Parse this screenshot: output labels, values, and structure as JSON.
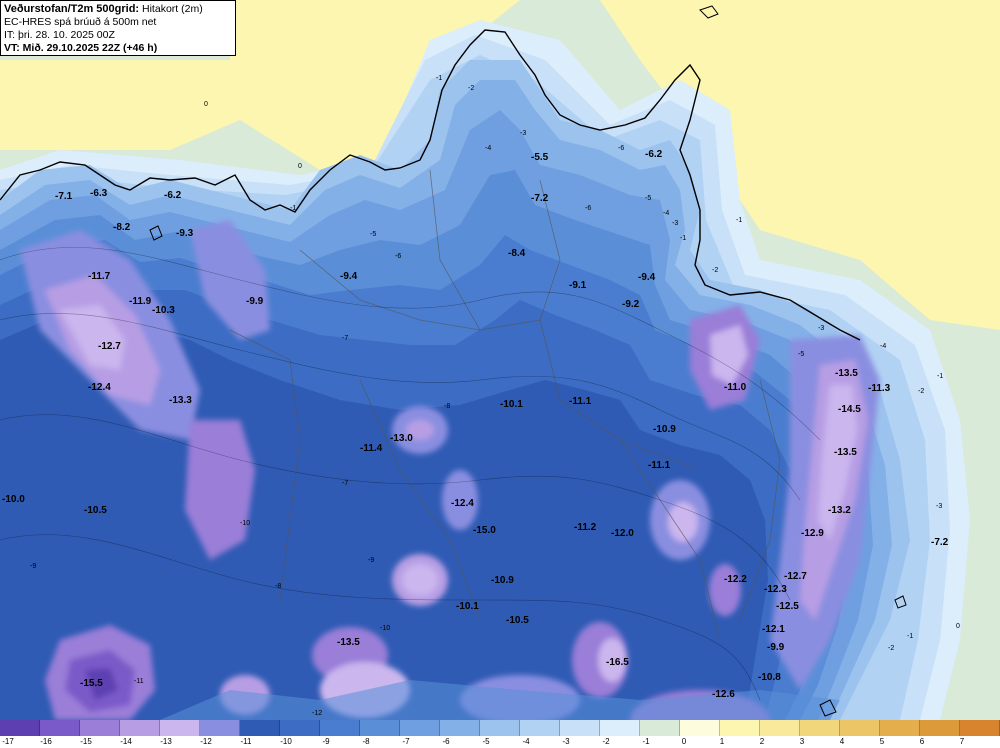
{
  "header": {
    "title": "Veðurstofan/T2m 500grid:",
    "subtitle": "Hitakort (2m)",
    "model": "EC-HRES spá brúuð á 500m net",
    "initial_time": "IT: þri. 28. 10. 2025 00Z",
    "valid_time": "VT: Mið. 29.10.2025 22Z (+46 h)"
  },
  "colors": {
    "sea": "#d9ead8",
    "land_far": "#fdf6b0",
    "coast": "#000000",
    "levels": {
      "-16": "#5d3fb2",
      "-15": "#7a5ac8",
      "-14": "#9a7ed8",
      "-13": "#b79ee4",
      "-12": "#cbb6ee",
      "-11": "#8a8ee0",
      "-10": "#2f5bb4",
      "-9": "#3c6cc4",
      "-8": "#4a7dcf",
      "-7": "#5a8fd8",
      "-6": "#6f9fe0",
      "-5": "#84b0e8",
      "-4": "#9cc2ee",
      "-3": "#b2d2f4",
      "-2": "#c8e0f8",
      "-1": "#dcedfb",
      "0": "#fdfcdc",
      "1": "#fdf6b0",
      "2": "#f8ea9a",
      "3": "#f1d67c",
      "4": "#ebc566",
      "5": "#e4ae4c",
      "6": "#dd9a3a",
      "7": "#d8842e"
    }
  },
  "map": {
    "contour_labels": [
      "0",
      "0",
      "-1",
      "-1",
      "-1",
      "-1",
      "-2",
      "-2",
      "-3",
      "-3",
      "-4",
      "-4",
      "-5",
      "-5",
      "-6",
      "-6",
      "-7",
      "-7",
      "-8",
      "-8",
      "-9",
      "-9",
      "-10",
      "-10",
      "-11",
      "-12",
      "-6",
      "-5",
      "-4",
      "-3",
      "-2",
      "-1",
      "0",
      "-1",
      "-2",
      "-3"
    ],
    "value_labels": [
      "-7.1",
      "-6.3",
      "-8.2",
      "-6.2",
      "-9.3",
      "-11.7",
      "-11.9",
      "-10.3",
      "-12.7",
      "-12.4",
      "-13.3",
      "-9.9",
      "-9.4",
      "-5.5",
      "-6.2",
      "-7.2",
      "-8.4",
      "-9.1",
      "-9.4",
      "-9.2",
      "-10.1",
      "-11.1",
      "-13.0",
      "-11.4",
      "-11.0",
      "-10.9",
      "-11.1",
      "-13.5",
      "-11.3",
      "-14.5",
      "-13.5",
      "-12.4",
      "-15.0",
      "-11.2",
      "-12.0",
      "-13.2",
      "-12.9",
      "-7.2",
      "-10.0",
      "-10.5",
      "-10.9",
      "-12.2",
      "-12.7",
      "-12.3",
      "-12.5",
      "-10.1",
      "-10.5",
      "-12.1",
      "-13.5",
      "-16.5",
      "-9.9",
      "-15.5",
      "-10.8",
      "-12.6"
    ]
  },
  "colorbar": {
    "ticks": [
      "-17",
      "-16",
      "-15",
      "-14",
      "-13",
      "-12",
      "-11",
      "-10",
      "-9",
      "-8",
      "-7",
      "-6",
      "-5",
      "-4",
      "-3",
      "-2",
      "-1",
      "0",
      "1",
      "2",
      "3",
      "4",
      "5",
      "6",
      "7"
    ]
  }
}
